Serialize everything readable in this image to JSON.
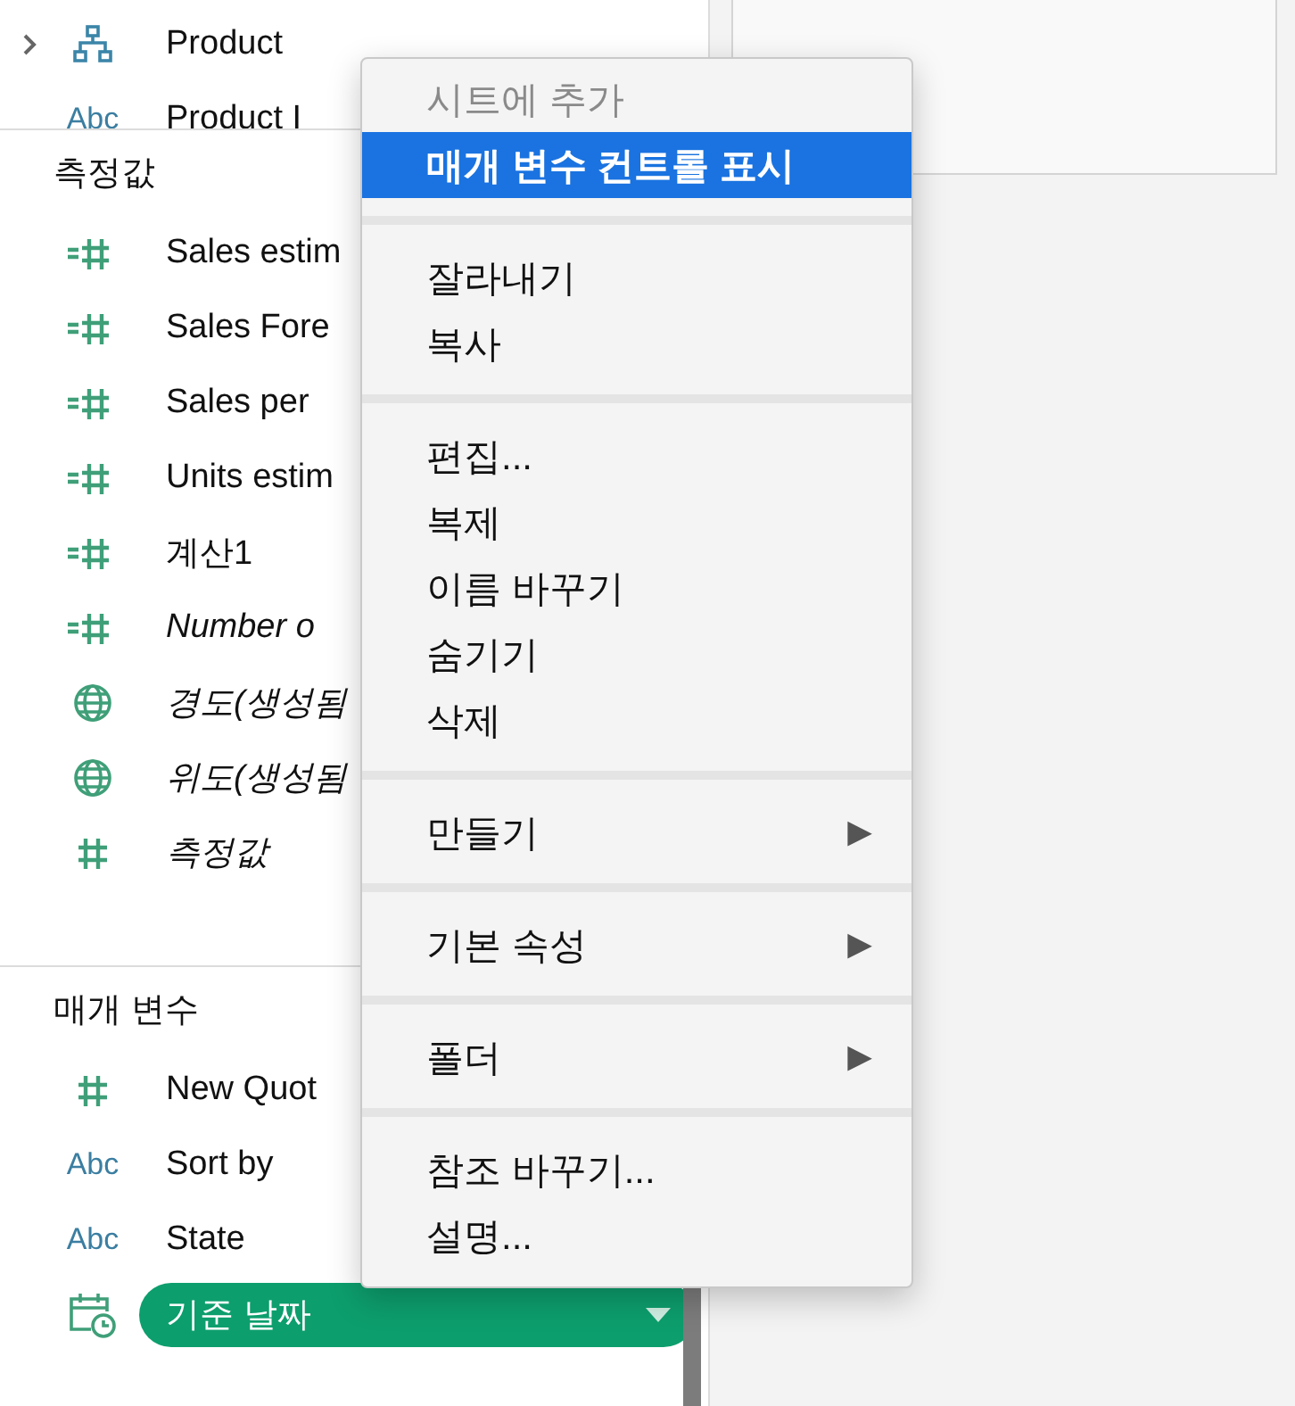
{
  "dimensions": {
    "rows": [
      {
        "name": "Product",
        "kind": "hierarchy",
        "expandable": true
      },
      {
        "name": "Product I",
        "kind": "string",
        "type_label": "Abc",
        "expandable": false
      }
    ]
  },
  "measures": {
    "title": "측정값",
    "rows": [
      {
        "name": "Sales estim",
        "kind": "calc",
        "italic": false
      },
      {
        "name": "Sales Fore",
        "kind": "calc",
        "italic": false
      },
      {
        "name": "Sales per",
        "kind": "calc",
        "italic": false
      },
      {
        "name": "Units estim",
        "kind": "calc",
        "italic": false
      },
      {
        "name": "계산1",
        "kind": "calc",
        "italic": false
      },
      {
        "name": "Number o",
        "kind": "calc",
        "italic": true
      },
      {
        "name": "경도(생성됨",
        "kind": "geo",
        "italic": true
      },
      {
        "name": "위도(생성됨",
        "kind": "geo",
        "italic": true
      },
      {
        "name": "측정값",
        "kind": "measure",
        "italic": true
      }
    ]
  },
  "parameters": {
    "title": "매개 변수",
    "rows": [
      {
        "name": "New Quot",
        "kind": "measure"
      },
      {
        "name": "Sort by",
        "kind": "string",
        "type_label": "Abc"
      },
      {
        "name": "State",
        "kind": "string",
        "type_label": "Abc"
      },
      {
        "name": "기준 날짜",
        "kind": "date",
        "selected": true
      }
    ]
  },
  "context_menu": {
    "groups": [
      [
        {
          "label": "시트에 추가",
          "disabled": true,
          "selected": false
        },
        {
          "label": "매개 변수 컨트롤 표시",
          "disabled": false,
          "selected": true
        }
      ],
      [
        {
          "label": "잘라내기",
          "disabled": false,
          "selected": false
        },
        {
          "label": "복사",
          "disabled": false,
          "selected": false
        }
      ],
      [
        {
          "label": "편집...",
          "disabled": false,
          "selected": false
        },
        {
          "label": "복제",
          "disabled": false,
          "selected": false
        },
        {
          "label": "이름 바꾸기",
          "disabled": false,
          "selected": false
        },
        {
          "label": "숨기기",
          "disabled": false,
          "selected": false
        },
        {
          "label": "삭제",
          "disabled": false,
          "selected": false
        }
      ],
      [
        {
          "label": "만들기",
          "disabled": false,
          "selected": false,
          "submenu_arrow": "▶"
        }
      ],
      [
        {
          "label": "기본 속성",
          "disabled": false,
          "selected": false,
          "submenu_arrow": "▶"
        }
      ],
      [
        {
          "label": "폴더",
          "disabled": false,
          "selected": false,
          "submenu_arrow": "▶"
        }
      ],
      [
        {
          "label": "참조 바꾸기...",
          "disabled": false,
          "selected": false
        },
        {
          "label": "설명...",
          "disabled": false,
          "selected": false
        }
      ]
    ]
  }
}
